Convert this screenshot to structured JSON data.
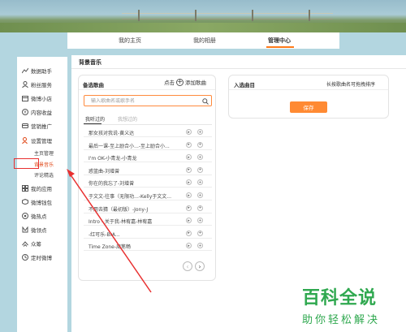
{
  "nav": {
    "items": [
      {
        "label": "我的主页"
      },
      {
        "label": "我的相册"
      },
      {
        "label": "管理中心",
        "active": true
      }
    ]
  },
  "sidebar": {
    "items": [
      {
        "label": "数据助手",
        "icon": "chart-icon"
      },
      {
        "label": "粉丝服务",
        "icon": "user-icon"
      },
      {
        "label": "微博小店",
        "icon": "store-icon"
      },
      {
        "label": "内容收益",
        "icon": "money-icon"
      },
      {
        "label": "营销推广",
        "icon": "card-icon"
      },
      {
        "label": "设置管理",
        "icon": "settings-user-icon"
      }
    ],
    "subitems": [
      {
        "label": "主页管理"
      },
      {
        "label": "背景音乐",
        "active": true
      },
      {
        "label": "评论精选"
      }
    ],
    "items_bottom": [
      {
        "label": "我的应用",
        "icon": "apps-icon"
      },
      {
        "label": "微博钱包",
        "icon": "wallet-icon"
      },
      {
        "label": "微热点",
        "icon": "hotspot-icon"
      },
      {
        "label": "微领点",
        "icon": "collar-icon"
      },
      {
        "label": "众筹",
        "icon": "crowdfund-icon"
      },
      {
        "label": "定时微博",
        "icon": "clock-icon"
      }
    ]
  },
  "main": {
    "title": "背景音乐",
    "left": {
      "title": "备选歌曲",
      "add_prefix": "点击",
      "add_label": "添加歌曲",
      "search_placeholder": "输入歌曲名或歌手名",
      "tabs": [
        "我听过的",
        "我想过的"
      ],
      "songs": [
        "那女孩对我说-黄义达",
        "最后一课-至上励合小...-至上励合小...",
        "I'm OK-小青龙-小青龙",
        "惑篮曲-刘增曾",
        "你在的我忘了-刘增曾",
        "于文文-往事（无限功...-Kelly于文文...",
        "不用去猜（最初版）-Jony-J",
        "Intro - 关于我-林宥嘉-林宥嘉",
        "-红可乐-BrA...",
        "Time Zone-周笔畅"
      ]
    },
    "right": {
      "title": "入选曲目",
      "hint": "长按歌曲名可拖拽排序",
      "save_label": "保存"
    }
  },
  "watermark": {
    "main": "百科全说",
    "sub": "助你轻松解决"
  },
  "colors": {
    "accent": "#ff8a33",
    "highlight_box": "#e83030",
    "arrow": "#e83030",
    "watermark": "#2fa84f"
  }
}
